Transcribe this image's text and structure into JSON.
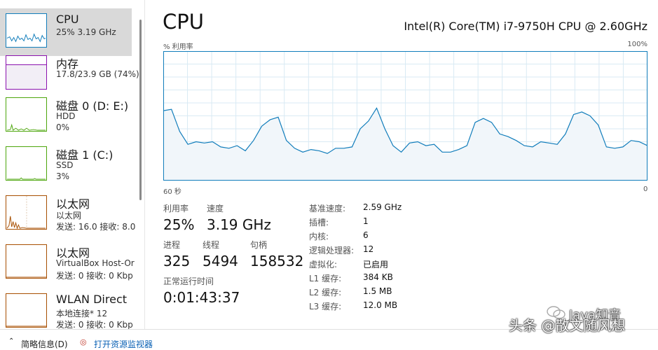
{
  "sidebar": {
    "items": [
      {
        "title": "CPU",
        "line1": "25% 3.19 GHz",
        "line2": "",
        "color": "#117dbb"
      },
      {
        "title": "内存",
        "line1": "17.8/23.9 GB (74%)",
        "line2": "",
        "color": "#8b12ae"
      },
      {
        "title": "磁盘 0 (D: E:)",
        "line1": "HDD",
        "line2": "0%",
        "color": "#4da60c"
      },
      {
        "title": "磁盘 1 (C:)",
        "line1": "SSD",
        "line2": "3%",
        "color": "#4da60c"
      },
      {
        "title": "以太网",
        "line1": "以太网",
        "line2": "发送: 16.0  接收: 8.0",
        "color": "#a74f01"
      },
      {
        "title": "以太网",
        "line1": "VirtualBox Host-Or",
        "line2": "发送: 0  接收: 0 Kbp",
        "color": "#a74f01"
      },
      {
        "title": "WLAN Direct",
        "line1": "本地连接* 12",
        "line2": "发送: 0  接收: 0 Kbp",
        "color": "#a74f01"
      }
    ]
  },
  "header": {
    "title": "CPU",
    "model": "Intel(R) Core(TM) i7-9750H CPU @ 2.60GHz"
  },
  "graph": {
    "util_label": "% 利用率",
    "max_label": "100%",
    "time_left": "60 秒",
    "time_right": "0",
    "line_color": "#117dbb",
    "grid_color": "#d9eaf4",
    "fill_color": "#f1f6fa",
    "values": [
      54,
      55,
      38,
      28,
      30,
      29,
      30,
      26,
      25,
      27,
      23,
      31,
      42,
      47,
      49,
      31,
      25,
      22,
      24,
      23,
      21,
      25,
      25,
      26,
      40,
      46,
      56,
      40,
      27,
      22,
      29,
      30,
      27,
      28,
      22,
      22,
      24,
      27,
      45,
      48,
      45,
      36,
      34,
      31,
      27,
      26,
      30,
      29,
      28,
      36,
      51,
      53,
      50,
      43,
      26,
      25,
      26,
      31,
      30,
      27
    ]
  },
  "stats": {
    "utilization": {
      "label": "利用率",
      "value": "25%"
    },
    "speed": {
      "label": "速度",
      "value": "3.19 GHz"
    },
    "processes": {
      "label": "进程",
      "value": "325"
    },
    "threads": {
      "label": "线程",
      "value": "5494"
    },
    "handles": {
      "label": "句柄",
      "value": "158532"
    },
    "uptime": {
      "label": "正常运行时间",
      "value": "0:01:43:37"
    }
  },
  "specs": [
    {
      "key": "基准速度:",
      "value": "2.59 GHz"
    },
    {
      "key": "插槽:",
      "value": "1"
    },
    {
      "key": "内核:",
      "value": "6"
    },
    {
      "key": "逻辑处理器:",
      "value": "12"
    },
    {
      "key": "虚拟化:",
      "value": "已启用"
    },
    {
      "key": "L1 缓存:",
      "value": "384 KB"
    },
    {
      "key": "L2 缓存:",
      "value": "1.5 MB"
    },
    {
      "key": "L3 缓存:",
      "value": "12.0 MB"
    }
  ],
  "footer": {
    "fewer_details": "简略信息(D)",
    "open_monitor": "打开资源监视器"
  },
  "watermark": {
    "top": "Java知音",
    "bottom": "头条 @散文随风想"
  }
}
